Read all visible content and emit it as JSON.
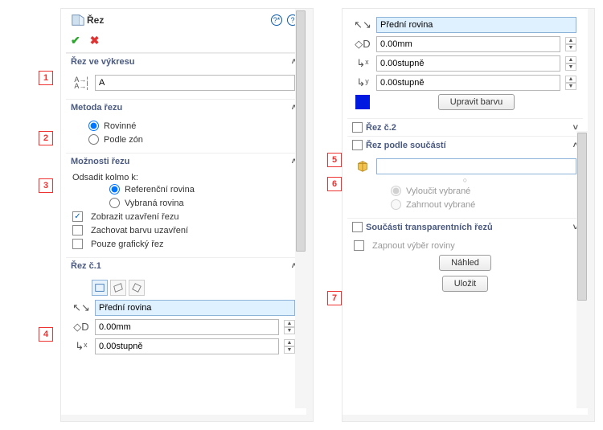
{
  "panel": {
    "title": "Řez",
    "sections": {
      "drawing": {
        "title": "Řez ve výkresu",
        "value": "A"
      },
      "method": {
        "title": "Metoda řezu",
        "opt_planar": "Rovinné",
        "opt_zones": "Podle zón"
      },
      "options": {
        "title": "Možnosti řezu",
        "offset_label": "Odsadit kolmo k:",
        "opt_ref": "Referenční rovina",
        "opt_sel": "Vybraná rovina",
        "chk_close": "Zobrazit uzavření řezu",
        "chk_color": "Zachovat barvu uzavření",
        "chk_graphic": "Pouze grafický řez"
      },
      "cut1": {
        "title": "Řez č.1",
        "plane": "Přední rovina",
        "offset": "0.00mm",
        "angle1": "0.00stupně",
        "angle2": "0.00stupně",
        "btn_color": "Upravit barvu"
      },
      "cut2": {
        "title": "Řez č.2"
      },
      "byparts": {
        "title": "Řez podle součástí",
        "opt_exclude": "Vyloučit vybrané",
        "opt_include": "Zahrnout vybrané"
      },
      "transparent": {
        "title": "Součásti transparentních řezů"
      },
      "plane_sel": {
        "chk": "Zapnout výběr roviny"
      },
      "buttons": {
        "preview": "Náhled",
        "save": "Uložit"
      }
    }
  },
  "callouts": {
    "n1": "1",
    "n2": "2",
    "n3": "3",
    "n4": "4",
    "n5": "5",
    "n6": "6",
    "n7": "7"
  }
}
